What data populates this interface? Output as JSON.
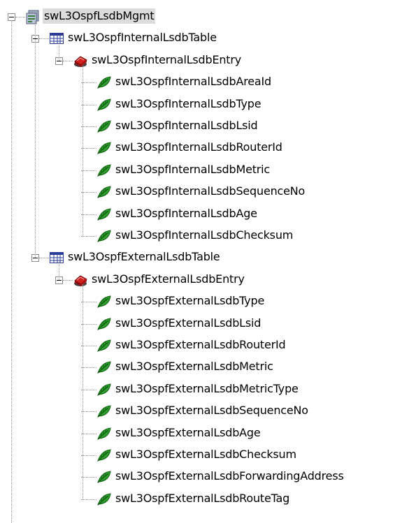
{
  "tree": {
    "root": {
      "label": "swL3OspfLsdbMgmt",
      "icon": "mib-module-icon",
      "selected": true,
      "expanded": true
    },
    "tables": [
      {
        "label": "swL3OspfInternalLsdbTable",
        "icon": "table-icon",
        "expanded": true,
        "entry": {
          "label": "swL3OspfInternalLsdbEntry",
          "icon": "entry-icon",
          "expanded": true,
          "leaves": [
            "swL3OspfInternalLsdbAreaId",
            "swL3OspfInternalLsdbType",
            "swL3OspfInternalLsdbLsid",
            "swL3OspfInternalLsdbRouterId",
            "swL3OspfInternalLsdbMetric",
            "swL3OspfInternalLsdbSequenceNo",
            "swL3OspfInternalLsdbAge",
            "swL3OspfInternalLsdbChecksum"
          ]
        }
      },
      {
        "label": "swL3OspfExternalLsdbTable",
        "icon": "table-icon",
        "expanded": true,
        "entry": {
          "label": "swL3OspfExternalLsdbEntry",
          "icon": "entry-icon",
          "expanded": true,
          "leaves": [
            "swL3OspfExternalLsdbType",
            "swL3OspfExternalLsdbLsid",
            "swL3OspfExternalLsdbRouterId",
            "swL3OspfExternalLsdbMetric",
            "swL3OspfExternalLsdbMetricType",
            "swL3OspfExternalLsdbSequenceNo",
            "swL3OspfExternalLsdbAge",
            "swL3OspfExternalLsdbChecksum",
            "swL3OspfExternalLsdbForwardingAddress",
            "swL3OspfExternalLsdbRouteTag"
          ]
        }
      }
    ],
    "leaf_icon": "leaf-icon",
    "colors": {
      "selection": "#dcdcdc",
      "connector": "#909090",
      "leaf": "#1c8a1c",
      "entry": "#cc2020",
      "table": "#2a3c98"
    }
  }
}
